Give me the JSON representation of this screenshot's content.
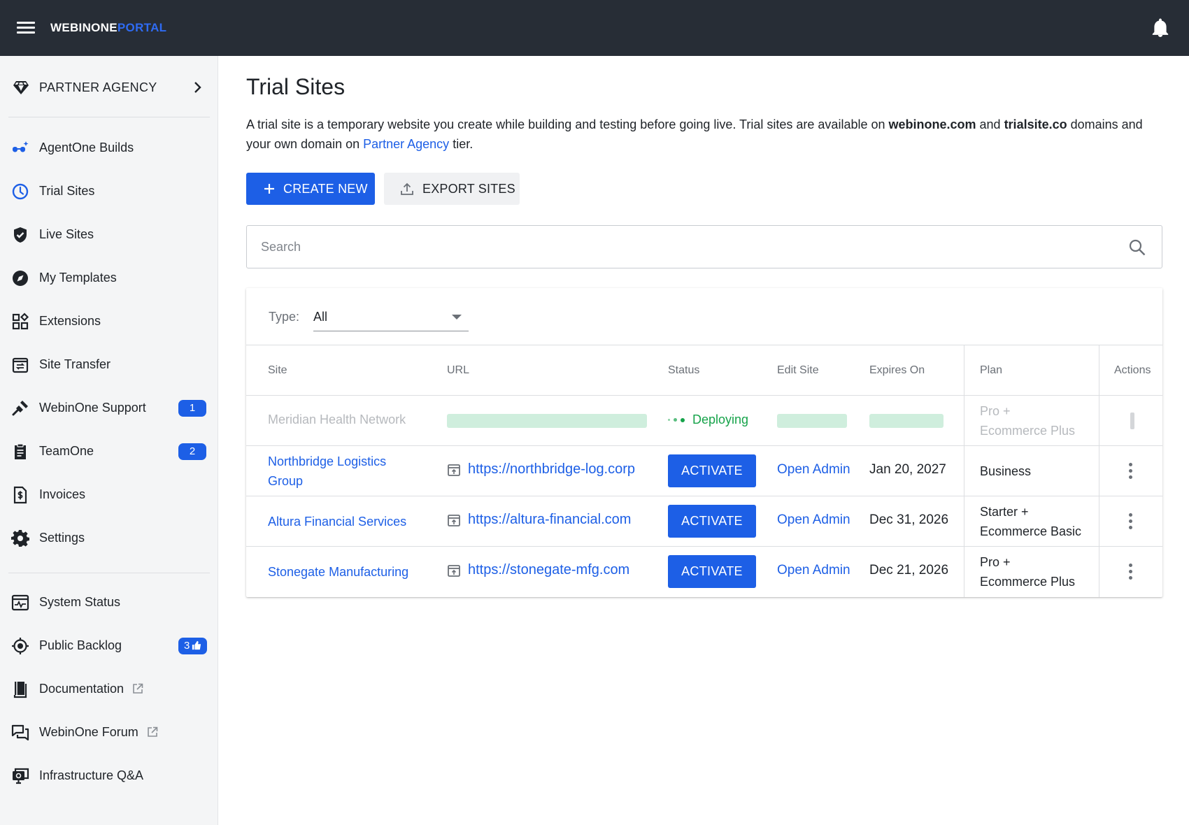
{
  "app": {
    "logo_primary": "WEBINONE",
    "logo_secondary": "PORTAL",
    "colors": {
      "topbar": "#272d36",
      "accent": "#1d5fe6",
      "success": "#16a34a"
    }
  },
  "sidebar": {
    "agency_label": "PARTNER AGENCY",
    "items": [
      {
        "label": "AgentOne Builds",
        "icon": "agent-builds-icon"
      },
      {
        "label": "Trial Sites",
        "icon": "clock-icon"
      },
      {
        "label": "Live Sites",
        "icon": "shield-check-icon"
      },
      {
        "label": "My Templates",
        "icon": "compass-icon"
      },
      {
        "label": "Extensions",
        "icon": "extensions-icon"
      },
      {
        "label": "Site Transfer",
        "icon": "site-transfer-icon"
      },
      {
        "label": "WebinOne Support",
        "icon": "support-icon",
        "badge": "1"
      },
      {
        "label": "TeamOne",
        "icon": "clipboard-icon",
        "badge": "2"
      },
      {
        "label": "Invoices",
        "icon": "invoice-icon"
      },
      {
        "label": "Settings",
        "icon": "gear-icon"
      }
    ],
    "resources": [
      {
        "label": "System Status",
        "icon": "system-status-icon"
      },
      {
        "label": "Public Backlog",
        "icon": "target-icon",
        "badge": "3"
      },
      {
        "label": "Documentation",
        "icon": "book-icon",
        "external": true
      },
      {
        "label": "WebinOne Forum",
        "icon": "forum-icon",
        "external": true
      },
      {
        "label": "Infrastructure Q&A",
        "icon": "monitor-qa-icon"
      }
    ]
  },
  "main": {
    "title": "Trial Sites",
    "intro": {
      "p1": "A trial site is a temporary website you create while building and testing before going live. Trial sites are available on ",
      "d1": "webinone.com",
      "p2": " and ",
      "d2": "trialsite.co",
      "p3": " domains and your own domain on ",
      "link": "Partner Agency",
      "p4": " tier."
    },
    "create_label": "CREATE NEW",
    "export_label": "EXPORT SITES",
    "search_placeholder": "Search",
    "filter": {
      "label": "Type:",
      "value": "All"
    },
    "columns": {
      "site": "Site",
      "url": "URL",
      "status": "Status",
      "edit": "Edit Site",
      "expires": "Expires On",
      "plan": "Plan",
      "actions": "Actions"
    },
    "deploying_row": {
      "site": "Meridian Health Network",
      "status": "Deploying",
      "plan_line1": "Pro +",
      "plan_line2": "Ecommerce Plus"
    },
    "rows": [
      {
        "site_line1": "Northbridge Logistics",
        "site_line2": "Group",
        "url": "https://northbridge-log.corp",
        "action": "ACTIVATE",
        "edit": "Open Admin",
        "expires": "Jan 20, 2027",
        "plan_line1": "Business",
        "plan_line2": ""
      },
      {
        "site_line1": "Altura Financial Services",
        "site_line2": "",
        "url": "https://altura-financial.com",
        "action": "ACTIVATE",
        "edit": "Open Admin",
        "expires": "Dec 31, 2026",
        "plan_line1": "Starter +",
        "plan_line2": "Ecommerce Basic"
      },
      {
        "site_line1": "Stonegate Manufacturing",
        "site_line2": "",
        "url": "https://stonegate-mfg.com",
        "action": "ACTIVATE",
        "edit": "Open Admin",
        "expires": "Dec 21, 2026",
        "plan_line1": "Pro +",
        "plan_line2": "Ecommerce Plus"
      }
    ]
  }
}
